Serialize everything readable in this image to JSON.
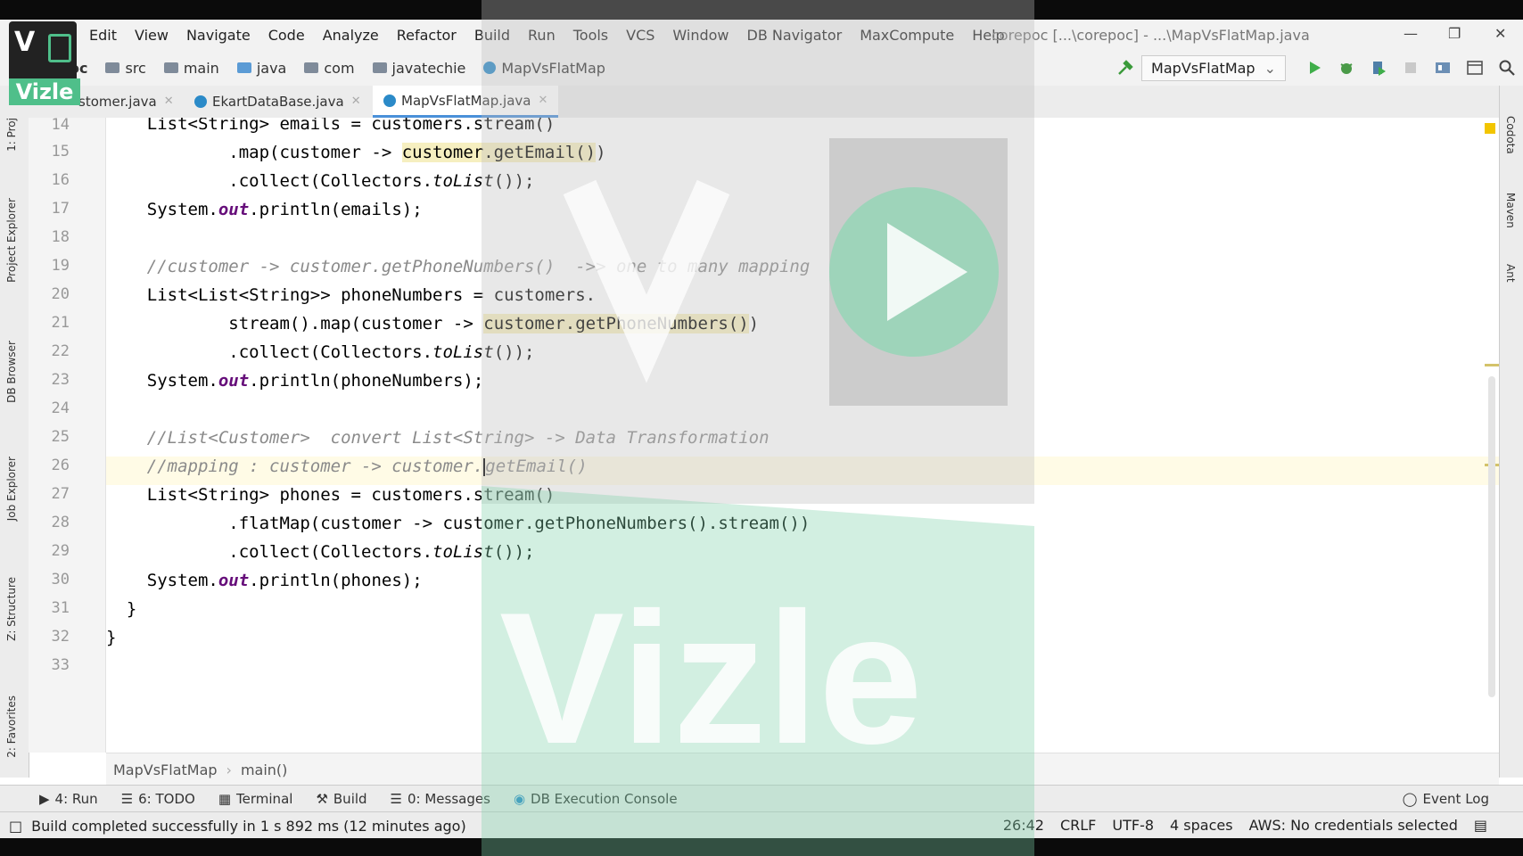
{
  "menu": [
    "Edit",
    "View",
    "Navigate",
    "Code",
    "Analyze",
    "Refactor",
    "Build",
    "Run",
    "Tools",
    "VCS",
    "Window",
    "DB Navigator",
    "MaxCompute",
    "Help"
  ],
  "window_title": "corepoc [...\\corepoc] - ...\\MapVsFlatMap.java",
  "breadcrumbs": [
    "src",
    "main",
    "java",
    "com",
    "javatechie",
    "MapVsFlatMap"
  ],
  "project_fragment": "oc",
  "run_config": "MapVsFlatMap",
  "tabs": [
    {
      "label": "stomer.java"
    },
    {
      "label": "EkartDataBase.java"
    },
    {
      "label": "MapVsFlatMap.java"
    }
  ],
  "left_tools": [
    "1: Proj",
    "Project Explorer",
    "DB Browser",
    "Job Explorer",
    "Z: Structure",
    "2: Favorites"
  ],
  "right_tools": [
    "Codota",
    "Maven",
    "Ant"
  ],
  "line_numbers": [
    "14",
    "15",
    "16",
    "17",
    "18",
    "19",
    "20",
    "21",
    "22",
    "23",
    "24",
    "25",
    "26",
    "27",
    "28",
    "29",
    "30",
    "31",
    "32",
    "33"
  ],
  "code": {
    "l14": "    List<String> emails = customers.stream()",
    "l15a": "            .map(customer -> ",
    "l15b": "customer.getEmail()",
    "l15c": ")",
    "l16a": "            .collect(Collectors.",
    "l16b": "toList",
    "l16c": "());",
    "l17a": "    System.",
    "l17b": "out",
    "l17c": ".println(emails);",
    "l19": "    //customer -> customer.getPhoneNumbers()  ->> one to many mapping",
    "l20": "    List<List<String>> phoneNumbers = customers.",
    "l21a": "            stream().map(customer -> ",
    "l21b": "customer.getPhoneNumbers()",
    "l21c": ")",
    "l22a": "            .collect(Collectors.",
    "l22b": "toList",
    "l22c": "());",
    "l23a": "    System.",
    "l23b": "out",
    "l23c": ".println(phoneNumbers);",
    "l25": "    //List<Customer>  convert List<String> -> Data Transformation",
    "l26a": "    //mapping : customer -> customer.",
    "l26b": "getEmail()",
    "l27": "    List<String> phones = customers.stream()",
    "l28": "            .flatMap(customer -> customer.getPhoneNumbers().stream())",
    "l29a": "            .collect(Collectors.",
    "l29b": "toList",
    "l29c": "());",
    "l30a": "    System.",
    "l30b": "out",
    "l30c": ".println(phones);",
    "l31": "  }",
    "l32": "}"
  },
  "editor_breadcrumb": [
    "MapVsFlatMap",
    "main()"
  ],
  "tool_windows": [
    "4: Run",
    "6: TODO",
    "Terminal",
    "Build",
    "0: Messages",
    "DB Execution Console"
  ],
  "event_log": "Event Log",
  "status": {
    "message": "Build completed successfully in 1 s 892 ms (12 minutes ago)",
    "position": "26:42",
    "line_sep": "CRLF",
    "encoding": "UTF-8",
    "indent": "4 spaces",
    "aws": "AWS: No credentials selected"
  },
  "watermark": {
    "logo_text": "Vizle",
    "big_text": "Vizle"
  },
  "colors": {
    "accent": "#4a90d9",
    "watermark_green": "#8fd7b4",
    "highlight": "#f6efc0"
  }
}
